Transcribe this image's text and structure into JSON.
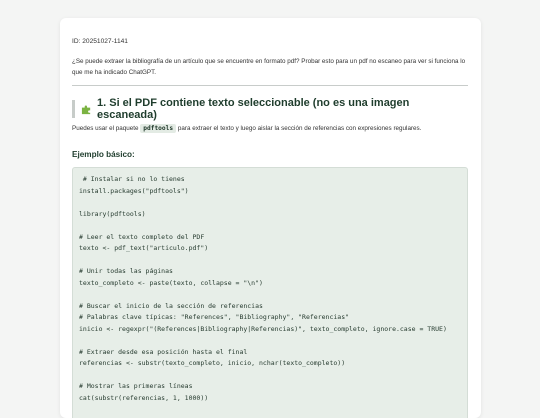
{
  "document": {
    "id_line": "ID: 20251027-1141",
    "question": "¿Se puede extraer la bibliografía de un artículo que se encuentre en formato pdf? Probar esto para un pdf no escaneo para ver si funciona lo que me ha indicado ChatGPT.",
    "section_icon": "puzzle-piece-icon",
    "section_title": "1. Si el PDF contiene texto seleccionable (no es una imagen escaneada)",
    "intro_before": "Puedes usar el paquete ",
    "intro_code": "pdftools",
    "intro_after": " para extraer el texto y luego aislar la sección de referencias con expresiones regulares.",
    "example_label": "Ejemplo básico:",
    "code_lines": [
      " # Instalar si no lo tienes",
      "install.packages(\"pdftools\")",
      "",
      "library(pdftools)",
      "",
      "# Leer el texto completo del PDF",
      "texto <- pdf_text(\"articulo.pdf\")",
      "",
      "# Unir todas las páginas",
      "texto_completo <- paste(texto, collapse = \"\\n\")",
      "",
      "# Buscar el inicio de la sección de referencias",
      "# Palabras clave típicas: \"References\", \"Bibliography\", \"Referencias\"",
      "inicio <- regexpr(\"(References|Bibliography|Referencias)\", texto_completo, ignore.case = TRUE)",
      "",
      "# Extraer desde esa posición hasta el final",
      "referencias <- substr(texto_completo, inicio, nchar(texto_completo))",
      "",
      "# Mostrar las primeras líneas",
      "cat(substr(referencias, 1, 1000))"
    ]
  },
  "colors": {
    "page_bg": "#f4f5f4",
    "heading": "#1f3d2d",
    "code_bg": "#e7eee8",
    "puzzle": "#7bb342"
  }
}
